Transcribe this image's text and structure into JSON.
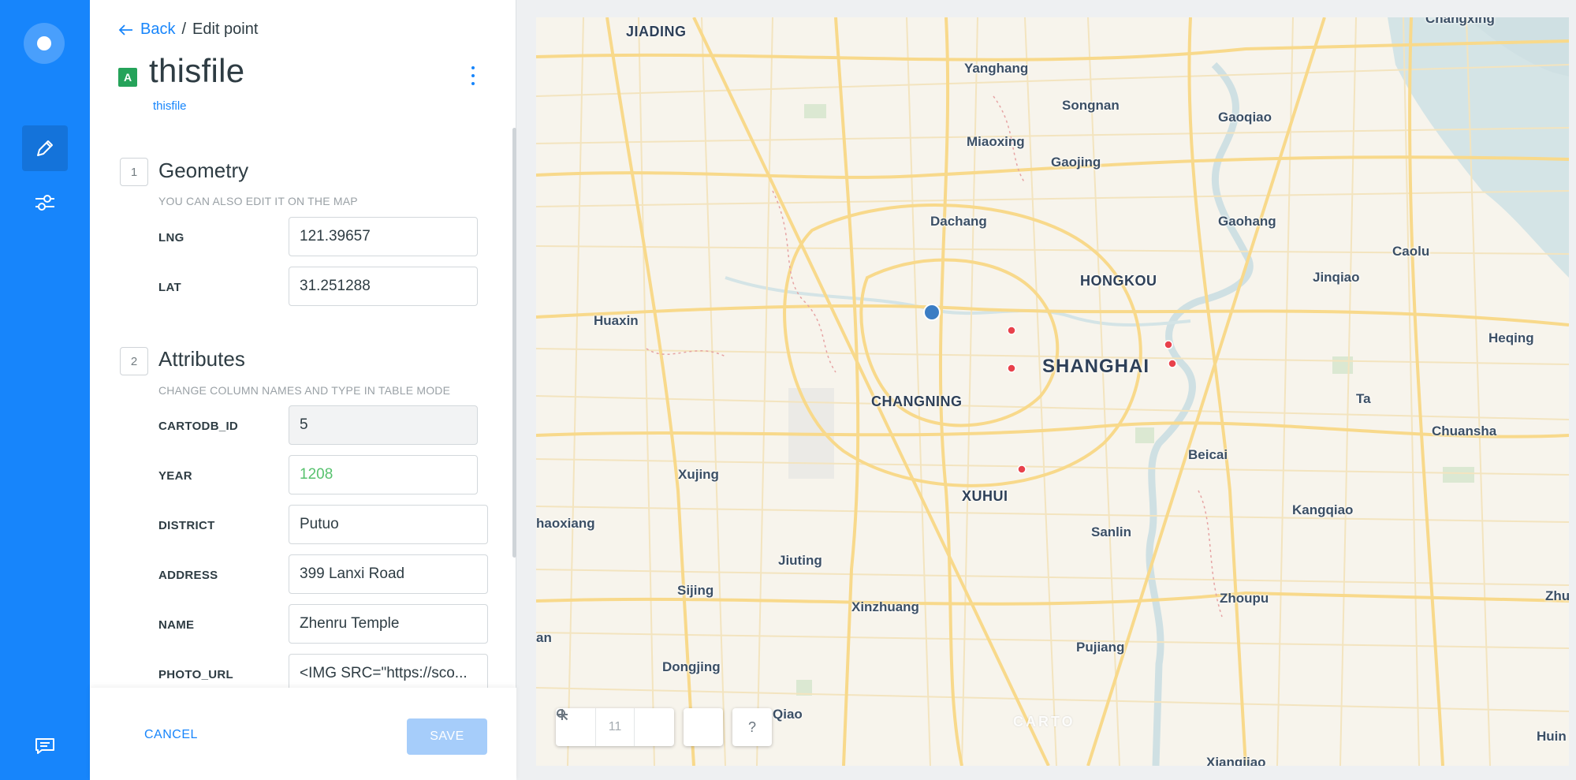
{
  "breadcrumb": {
    "back_label": "Back",
    "separator": "/",
    "current": "Edit point"
  },
  "layer": {
    "badge": "A",
    "title": "thisfile",
    "subtitle": "thisfile"
  },
  "geometry": {
    "number": "1",
    "title": "Geometry",
    "hint": "YOU CAN ALSO EDIT IT ON THE MAP",
    "fields": [
      {
        "label": "LNG",
        "value": "121.39657"
      },
      {
        "label": "LAT",
        "value": "31.251288"
      }
    ]
  },
  "attributes": {
    "number": "2",
    "title": "Attributes",
    "hint": "CHANGE COLUMN NAMES AND TYPE IN TABLE MODE",
    "fields": [
      {
        "label": "CARTODB_ID",
        "value": "5"
      },
      {
        "label": "YEAR",
        "value": "1208"
      },
      {
        "label": "DISTRICT",
        "value": "Putuo"
      },
      {
        "label": "ADDRESS",
        "value": "399 Lanxi Road"
      },
      {
        "label": "NAME",
        "value": "Zhenru Temple"
      },
      {
        "label": "PHOTO_URL",
        "value": "<IMG SRC=\"https://sco..."
      }
    ]
  },
  "footer": {
    "cancel_label": "CANCEL",
    "save_label": "SAVE"
  },
  "map": {
    "places": [
      {
        "name": "JIADING",
        "kind": "district"
      },
      {
        "name": "Yanghang",
        "kind": "town"
      },
      {
        "name": "Songnan",
        "kind": "town"
      },
      {
        "name": "Gaoqiao",
        "kind": "town"
      },
      {
        "name": "Miaoxing",
        "kind": "town"
      },
      {
        "name": "Gaojing",
        "kind": "town"
      },
      {
        "name": "Dachang",
        "kind": "town"
      },
      {
        "name": "Gaohang",
        "kind": "town"
      },
      {
        "name": "Caolu",
        "kind": "town"
      },
      {
        "name": "HONGKOU",
        "kind": "district"
      },
      {
        "name": "Jinqiao",
        "kind": "town"
      },
      {
        "name": "Huaxin",
        "kind": "town"
      },
      {
        "name": "SHANGHAI",
        "kind": "city"
      },
      {
        "name": "Heqing",
        "kind": "town"
      },
      {
        "name": "CHANGNING",
        "kind": "district"
      },
      {
        "name": "Ta",
        "kind": "town"
      },
      {
        "name": "Chuansha",
        "kind": "town"
      },
      {
        "name": "Beicai",
        "kind": "town"
      },
      {
        "name": "Xujing",
        "kind": "town"
      },
      {
        "name": "XUHUI",
        "kind": "district"
      },
      {
        "name": "haoxiang",
        "kind": "town"
      },
      {
        "name": "Kangqiao",
        "kind": "town"
      },
      {
        "name": "Sanlin",
        "kind": "town"
      },
      {
        "name": "Jiuting",
        "kind": "town"
      },
      {
        "name": "Sijing",
        "kind": "town"
      },
      {
        "name": "Zhoupu",
        "kind": "town"
      },
      {
        "name": "Xinzhuang",
        "kind": "town"
      },
      {
        "name": "Zhu",
        "kind": "town"
      },
      {
        "name": "an",
        "kind": "town"
      },
      {
        "name": "Pujiang",
        "kind": "town"
      },
      {
        "name": "Dongjing",
        "kind": "town"
      },
      {
        "name": "Qiao",
        "kind": "town"
      },
      {
        "name": "Huin",
        "kind": "town"
      },
      {
        "name": "Xiangjiao",
        "kind": "town"
      },
      {
        "name": "Changxing",
        "kind": "town"
      }
    ],
    "zoom_level": "11",
    "attribution": "CARTO",
    "colors": {
      "road": "#f8d98b",
      "water": "#d4e4e6",
      "selected_point": "#3b7dc4",
      "point": "#e8414b"
    }
  }
}
